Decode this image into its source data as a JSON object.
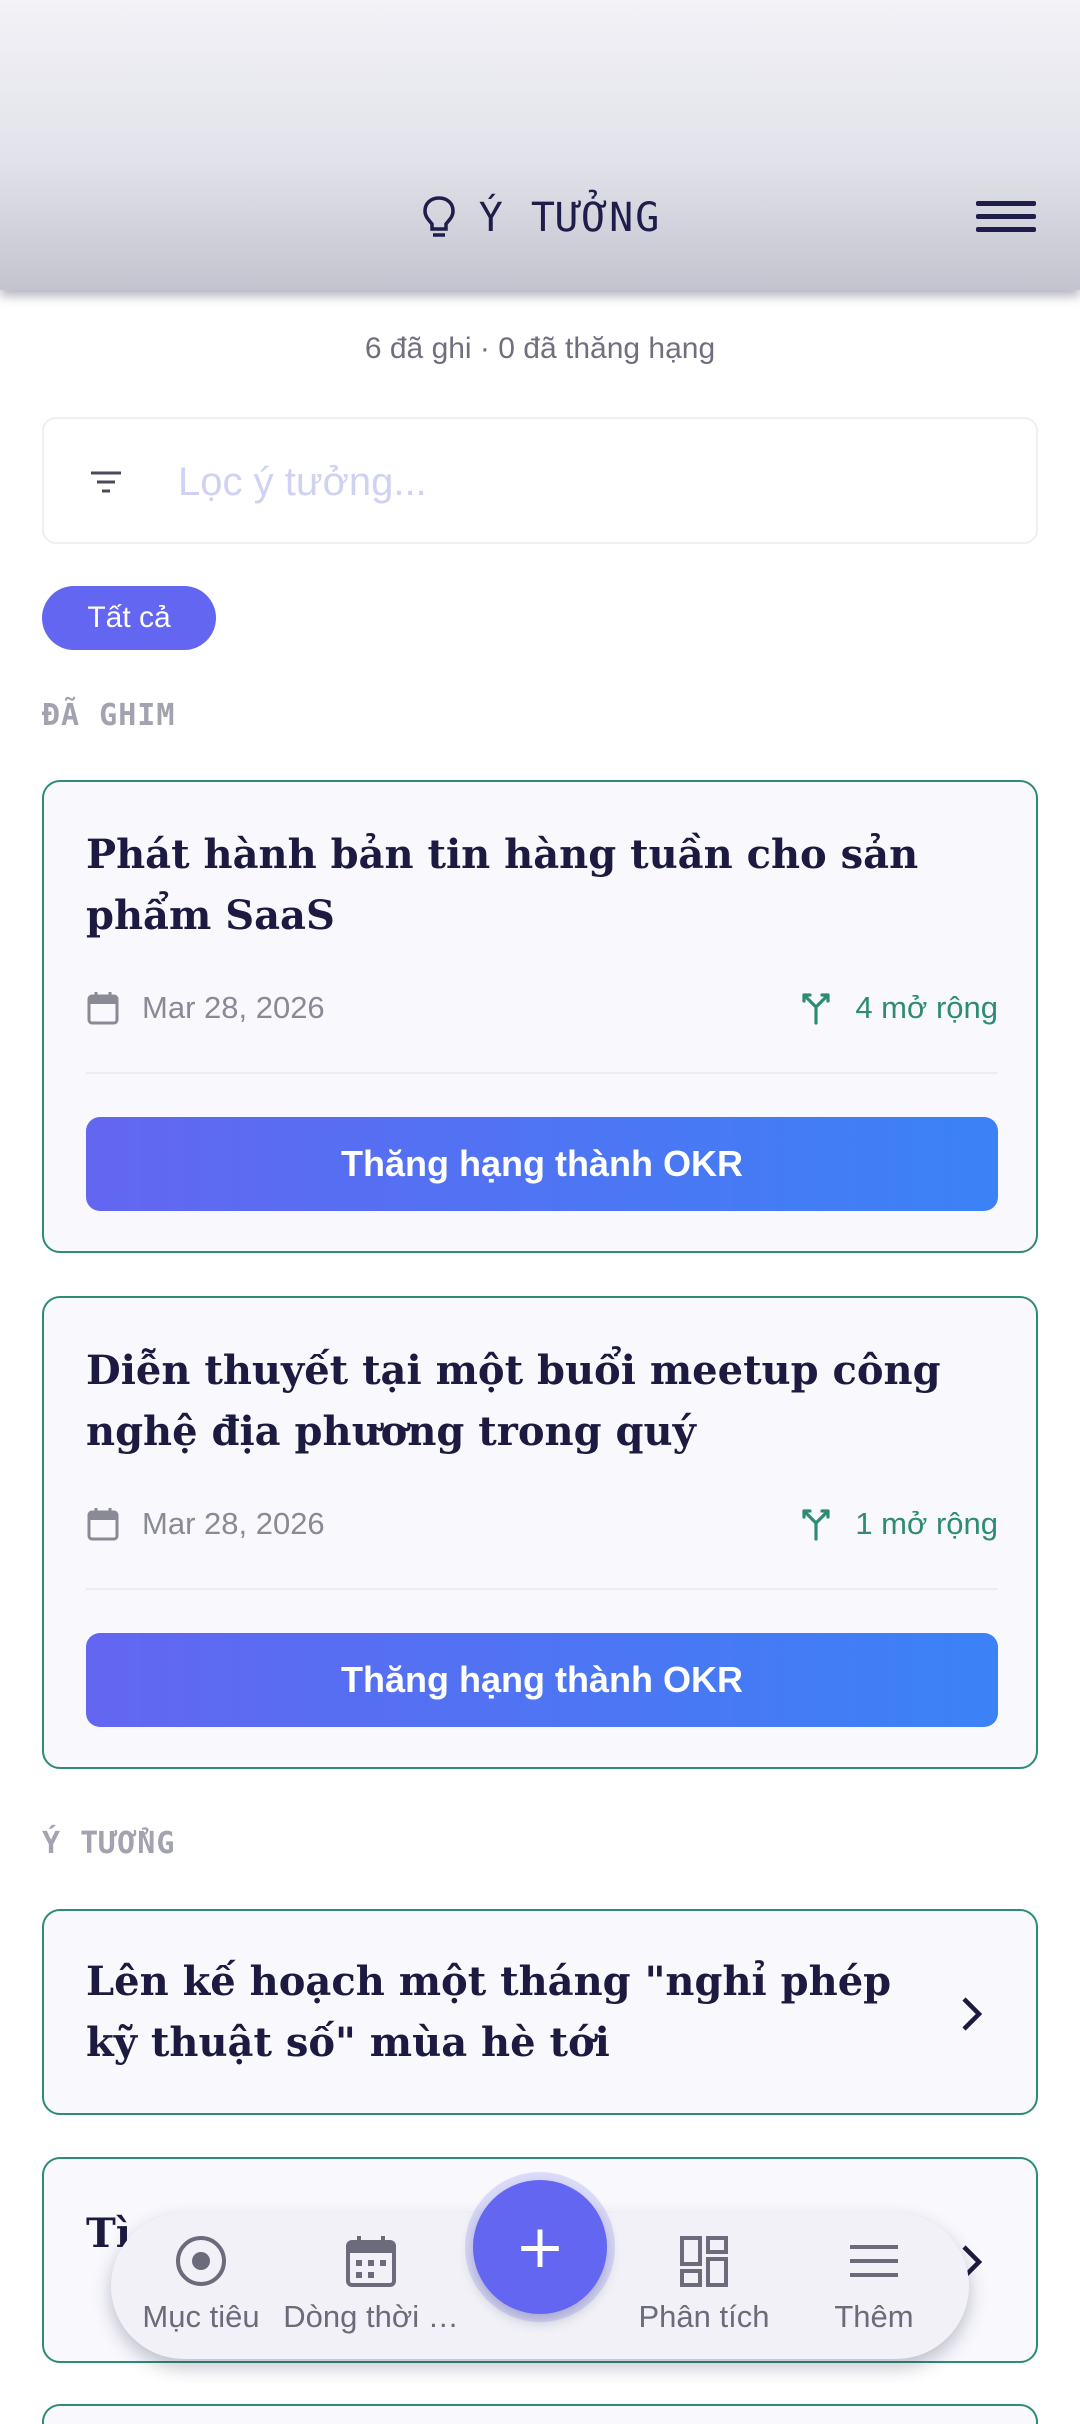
{
  "header": {
    "title": "Ý TƯỞNG",
    "icon": "lightbulb-icon",
    "menu_icon": "hamburger-menu-icon"
  },
  "stats": "6 đã ghi · 0 đã thăng hạng",
  "filter": {
    "placeholder": "Lọc ý tưởng...",
    "value": ""
  },
  "chips": [
    {
      "label": "Tất cả",
      "active": true
    }
  ],
  "sections": {
    "pinned_label": "ĐÃ GHIM",
    "ideas_label": "Ý TƯỞNG"
  },
  "pinned_cards": [
    {
      "title": "Phát hành bản tin hàng tuần cho sản phẩm SaaS",
      "date": "Mar 28, 2026",
      "expansions": "4 mở rộng",
      "button": "Thăng hạng thành OKR"
    },
    {
      "title": "Diễn thuyết tại một buổi meetup công nghệ địa phương trong quý",
      "date": "Mar 28, 2026",
      "expansions": "1 mở rộng",
      "button": "Thăng hạng thành OKR"
    }
  ],
  "idea_cards": [
    {
      "title": "Lên kế hoạch một tháng \"nghỉ phép kỹ thuật số\" mùa hè tới"
    },
    {
      "title": "Tì c"
    }
  ],
  "bottom_nav": {
    "items": [
      {
        "label": "Mục tiêu",
        "icon": "target-icon"
      },
      {
        "label": "Dòng thời …",
        "icon": "calendar-icon"
      },
      {
        "label": "Phân tích",
        "icon": "dashboard-icon"
      },
      {
        "label": "Thêm",
        "icon": "menu-icon"
      }
    ],
    "fab_label": "+"
  },
  "colors": {
    "accent": "#6366f1",
    "accent_blue": "#3b82f6",
    "teal": "#2e8b75"
  }
}
